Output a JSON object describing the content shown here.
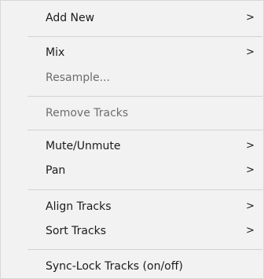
{
  "menu": {
    "items": [
      {
        "label": "Add New",
        "submenu": true,
        "enabled": true
      },
      {
        "label": "Mix",
        "submenu": true,
        "enabled": true
      },
      {
        "label": "Resample...",
        "submenu": false,
        "enabled": false
      },
      {
        "label": "Remove Tracks",
        "submenu": false,
        "enabled": false
      },
      {
        "label": "Mute/Unmute",
        "submenu": true,
        "enabled": true
      },
      {
        "label": "Pan",
        "submenu": true,
        "enabled": true
      },
      {
        "label": "Align Tracks",
        "submenu": true,
        "enabled": true
      },
      {
        "label": "Sort Tracks",
        "submenu": true,
        "enabled": true
      },
      {
        "label": "Sync-Lock Tracks (on/off)",
        "submenu": false,
        "enabled": true
      }
    ],
    "submenu_glyph": ">",
    "colors": {
      "background": "#f2f2f2",
      "text": "#1b1b1b",
      "disabled_text": "#6d6d6d",
      "separator": "#d2d2d2"
    }
  }
}
